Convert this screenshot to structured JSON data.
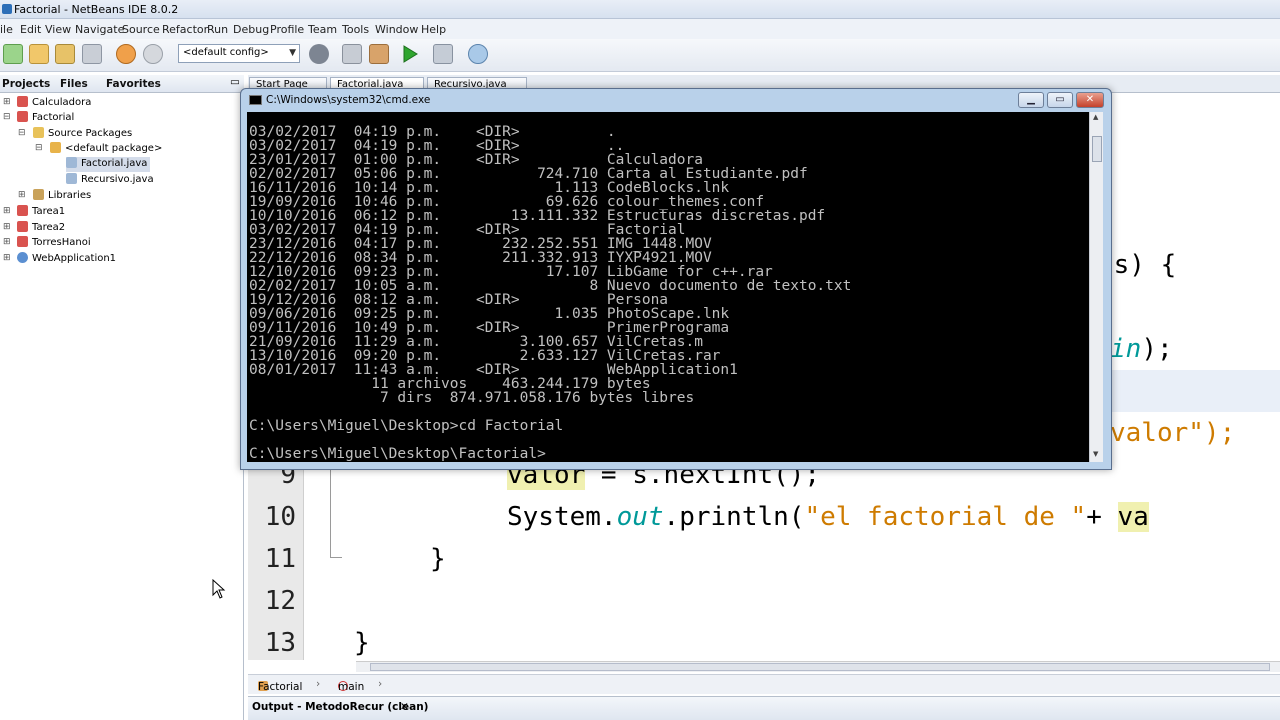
{
  "window": {
    "title": "Factorial - NetBeans IDE 8.0.2"
  },
  "menu": [
    "ile",
    "Edit",
    "View",
    "Navigate",
    "Source",
    "Refactor",
    "Run",
    "Debug",
    "Profile",
    "Team",
    "Tools",
    "Window",
    "Help"
  ],
  "toolbar": {
    "config_select": "<default config>"
  },
  "left_tabs": [
    "Projects",
    "Files",
    "Favorites"
  ],
  "tree": [
    {
      "label": "Calculadora"
    },
    {
      "label": "Factorial"
    },
    {
      "label": "Source Packages"
    },
    {
      "label": "<default package>"
    },
    {
      "label": "Factorial.java"
    },
    {
      "label": "Recursivo.java"
    },
    {
      "label": "Libraries"
    },
    {
      "label": "Tarea1"
    },
    {
      "label": "Tarea2"
    },
    {
      "label": "TorresHanoi"
    },
    {
      "label": "WebApplication1"
    }
  ],
  "editor_tabs": [
    "Start Page",
    "Factorial.java",
    "Recursivo.java"
  ],
  "code": {
    "line_numbers": [
      "9",
      "10",
      "11",
      "12",
      "13"
    ],
    "frag_gs": "gs) {",
    "frag_in": "in",
    "frag_in_end": ");",
    "frag_valor": "valor\");",
    "line9_a": "valor",
    "line9_b": " = s.nextInt();",
    "line10_a": "System.",
    "line10_b": "out",
    "line10_c": ".println(",
    "line10_d": "\"el factorial de \"",
    "line10_e": "+ ",
    "line10_f": "va",
    "line11": "}",
    "line13": "}"
  },
  "navbar": {
    "class": "Factorial",
    "method": "main"
  },
  "output_tab": "Output - MetodoRecur (clean)",
  "cmd": {
    "title": "C:\\Windows\\system32\\cmd.exe",
    "lines": [
      "03/02/2017  04:19 p.m.    <DIR>          .",
      "03/02/2017  04:19 p.m.    <DIR>          ..",
      "23/01/2017  01:00 p.m.    <DIR>          Calculadora",
      "02/02/2017  05:06 p.m.           724.710 Carta al Estudiante.pdf",
      "16/11/2016  10:14 p.m.             1.113 CodeBlocks.lnk",
      "19/09/2016  10:46 p.m.            69.626 colour_themes.conf",
      "10/10/2016  06:12 p.m.        13.111.332 Estructuras discretas.pdf",
      "03/02/2017  04:19 p.m.    <DIR>          Factorial",
      "23/12/2016  04:17 p.m.       232.252.551 IMG_1448.MOV",
      "22/12/2016  08:34 p.m.       211.332.913 IYXP4921.MOV",
      "12/10/2016  09:23 p.m.            17.107 LibGame for c++.rar",
      "02/02/2017  10:05 a.m.                 8 Nuevo documento de texto.txt",
      "19/12/2016  08:12 a.m.    <DIR>          Persona",
      "09/06/2016  09:25 p.m.             1.035 PhotoScape.lnk",
      "09/11/2016  10:49 p.m.    <DIR>          PrimerPrograma",
      "21/09/2016  11:29 a.m.         3.100.657 VilCretas.m",
      "13/10/2016  09:20 p.m.         2.633.127 VilCretas.rar",
      "08/01/2017  11:43 a.m.    <DIR>          WebApplication1",
      "              11 archivos    463.244.179 bytes",
      "               7 dirs  874.971.058.176 bytes libres",
      "",
      "C:\\Users\\Miguel\\Desktop>cd Factorial",
      "",
      "C:\\Users\\Miguel\\Desktop\\Factorial>"
    ]
  },
  "colors": {
    "accent": "#2d6fb8",
    "string": "#ce7b00",
    "console_bg": "#000000",
    "console_fg": "#c0c0c0"
  }
}
